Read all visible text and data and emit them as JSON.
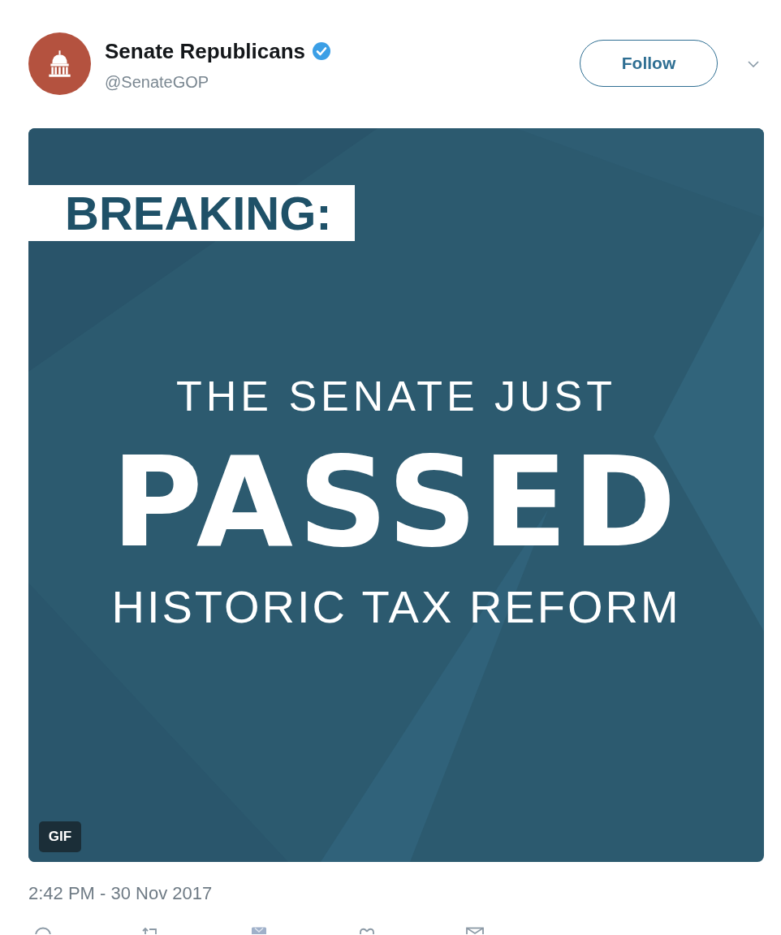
{
  "tweet": {
    "author": {
      "name": "Senate Republicans",
      "handle": "@SenateGOP",
      "verified": true
    },
    "follow_button": {
      "label": "Follow"
    },
    "media": {
      "label": "BREAKING:",
      "lines": [
        {
          "kind": "subtitle",
          "text": "THE SENATE JUST"
        },
        {
          "kind": "headline",
          "text": "PASSED"
        },
        {
          "kind": "subtitle",
          "text": "HISTORIC TAX REFORM"
        }
      ],
      "badge": "GIF"
    },
    "timestamp": "2:42 PM - 30 Nov 2017",
    "actions": [
      {
        "kind": "reply"
      },
      {
        "kind": "retweet"
      },
      {
        "kind": "tile"
      },
      {
        "kind": "like"
      },
      {
        "kind": "message"
      }
    ]
  }
}
